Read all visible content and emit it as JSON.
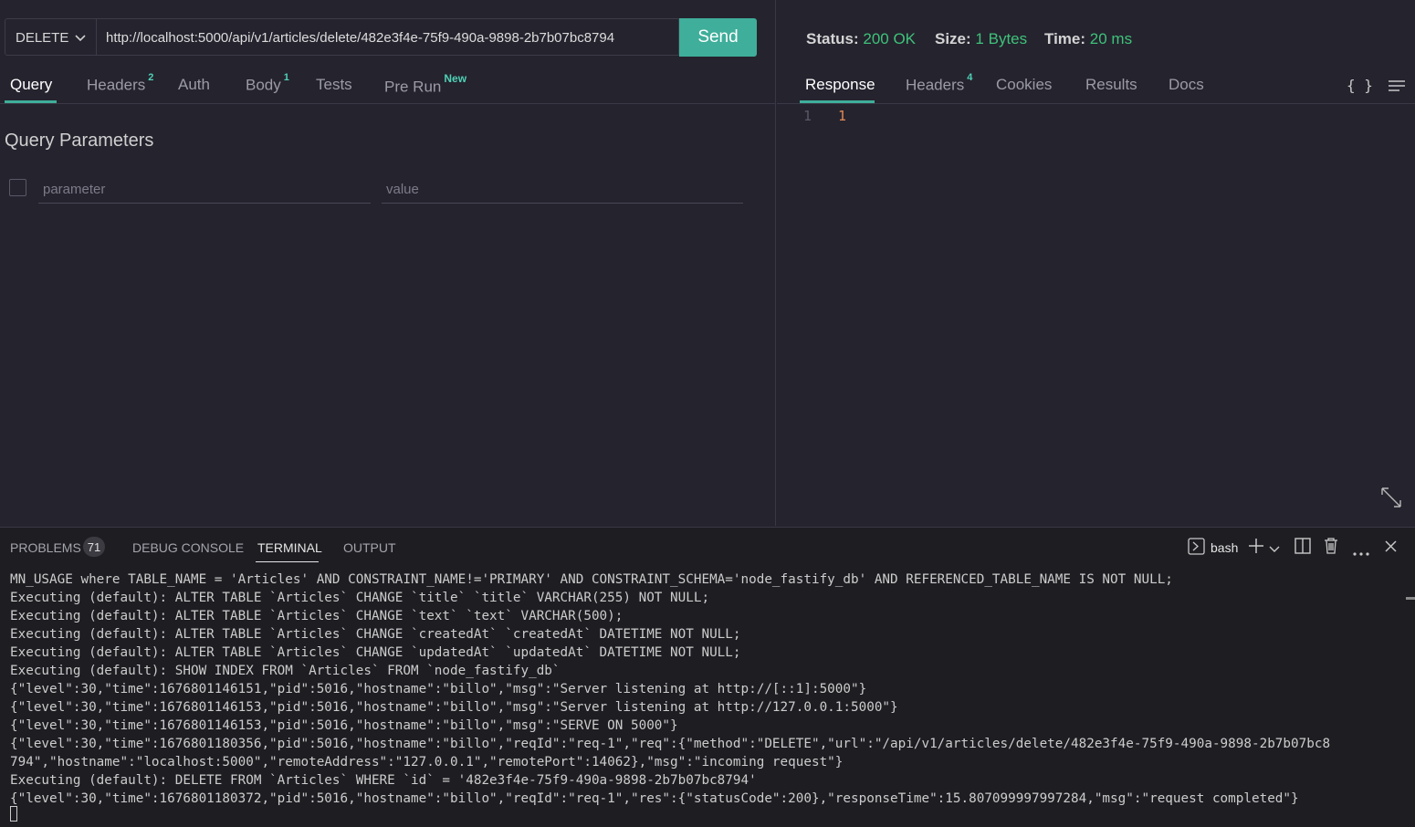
{
  "request": {
    "method": "DELETE",
    "url": "http://localhost:5000/api/v1/articles/delete/482e3f4e-75f9-490a-9898-2b7b07bc8794",
    "send_label": "Send"
  },
  "request_tabs": {
    "query": "Query",
    "headers": "Headers",
    "headers_count": "2",
    "auth": "Auth",
    "body": "Body",
    "body_count": "1",
    "tests": "Tests",
    "prerun": "Pre Run",
    "prerun_badge": "New"
  },
  "query_params": {
    "title": "Query Parameters",
    "param_placeholder": "parameter",
    "value_placeholder": "value"
  },
  "response_status": {
    "status_label": "Status:",
    "status_value": "200 OK",
    "size_label": "Size:",
    "size_value": "1 Bytes",
    "time_label": "Time:",
    "time_value": "20 ms",
    "value_color": "#3ec27a"
  },
  "response_tabs": {
    "response": "Response",
    "headers": "Headers",
    "headers_count": "4",
    "cookies": "Cookies",
    "results": "Results",
    "docs": "Docs"
  },
  "response_body": {
    "line_number": "1",
    "content": "1"
  },
  "panel": {
    "problems": "PROBLEMS",
    "problems_count": "71",
    "debug_console": "DEBUG CONSOLE",
    "terminal": "TERMINAL",
    "output": "OUTPUT",
    "shell": "bash"
  },
  "terminal_lines": [
    "MN_USAGE where TABLE_NAME = 'Articles' AND CONSTRAINT_NAME!='PRIMARY' AND CONSTRAINT_SCHEMA='node_fastify_db' AND REFERENCED_TABLE_NAME IS NOT NULL;",
    "Executing (default): ALTER TABLE `Articles` CHANGE `title` `title` VARCHAR(255) NOT NULL;",
    "Executing (default): ALTER TABLE `Articles` CHANGE `text` `text` VARCHAR(500);",
    "Executing (default): ALTER TABLE `Articles` CHANGE `createdAt` `createdAt` DATETIME NOT NULL;",
    "Executing (default): ALTER TABLE `Articles` CHANGE `updatedAt` `updatedAt` DATETIME NOT NULL;",
    "Executing (default): SHOW INDEX FROM `Articles` FROM `node_fastify_db`",
    "{\"level\":30,\"time\":1676801146151,\"pid\":5016,\"hostname\":\"billo\",\"msg\":\"Server listening at http://[::1]:5000\"}",
    "{\"level\":30,\"time\":1676801146153,\"pid\":5016,\"hostname\":\"billo\",\"msg\":\"Server listening at http://127.0.0.1:5000\"}",
    "{\"level\":30,\"time\":1676801146153,\"pid\":5016,\"hostname\":\"billo\",\"msg\":\"SERVE ON 5000\"}",
    "{\"level\":30,\"time\":1676801180356,\"pid\":5016,\"hostname\":\"billo\",\"reqId\":\"req-1\",\"req\":{\"method\":\"DELETE\",\"url\":\"/api/v1/articles/delete/482e3f4e-75f9-490a-9898-2b7b07bc8",
    "794\",\"hostname\":\"localhost:5000\",\"remoteAddress\":\"127.0.0.1\",\"remotePort\":14062},\"msg\":\"incoming request\"}",
    "Executing (default): DELETE FROM `Articles` WHERE `id` = '482e3f4e-75f9-490a-9898-2b7b07bc8794'",
    "{\"level\":30,\"time\":1676801180372,\"pid\":5016,\"hostname\":\"billo\",\"reqId\":\"req-1\",\"res\":{\"statusCode\":200},\"responseTime\":15.807099997997284,\"msg\":\"request completed\"}"
  ]
}
